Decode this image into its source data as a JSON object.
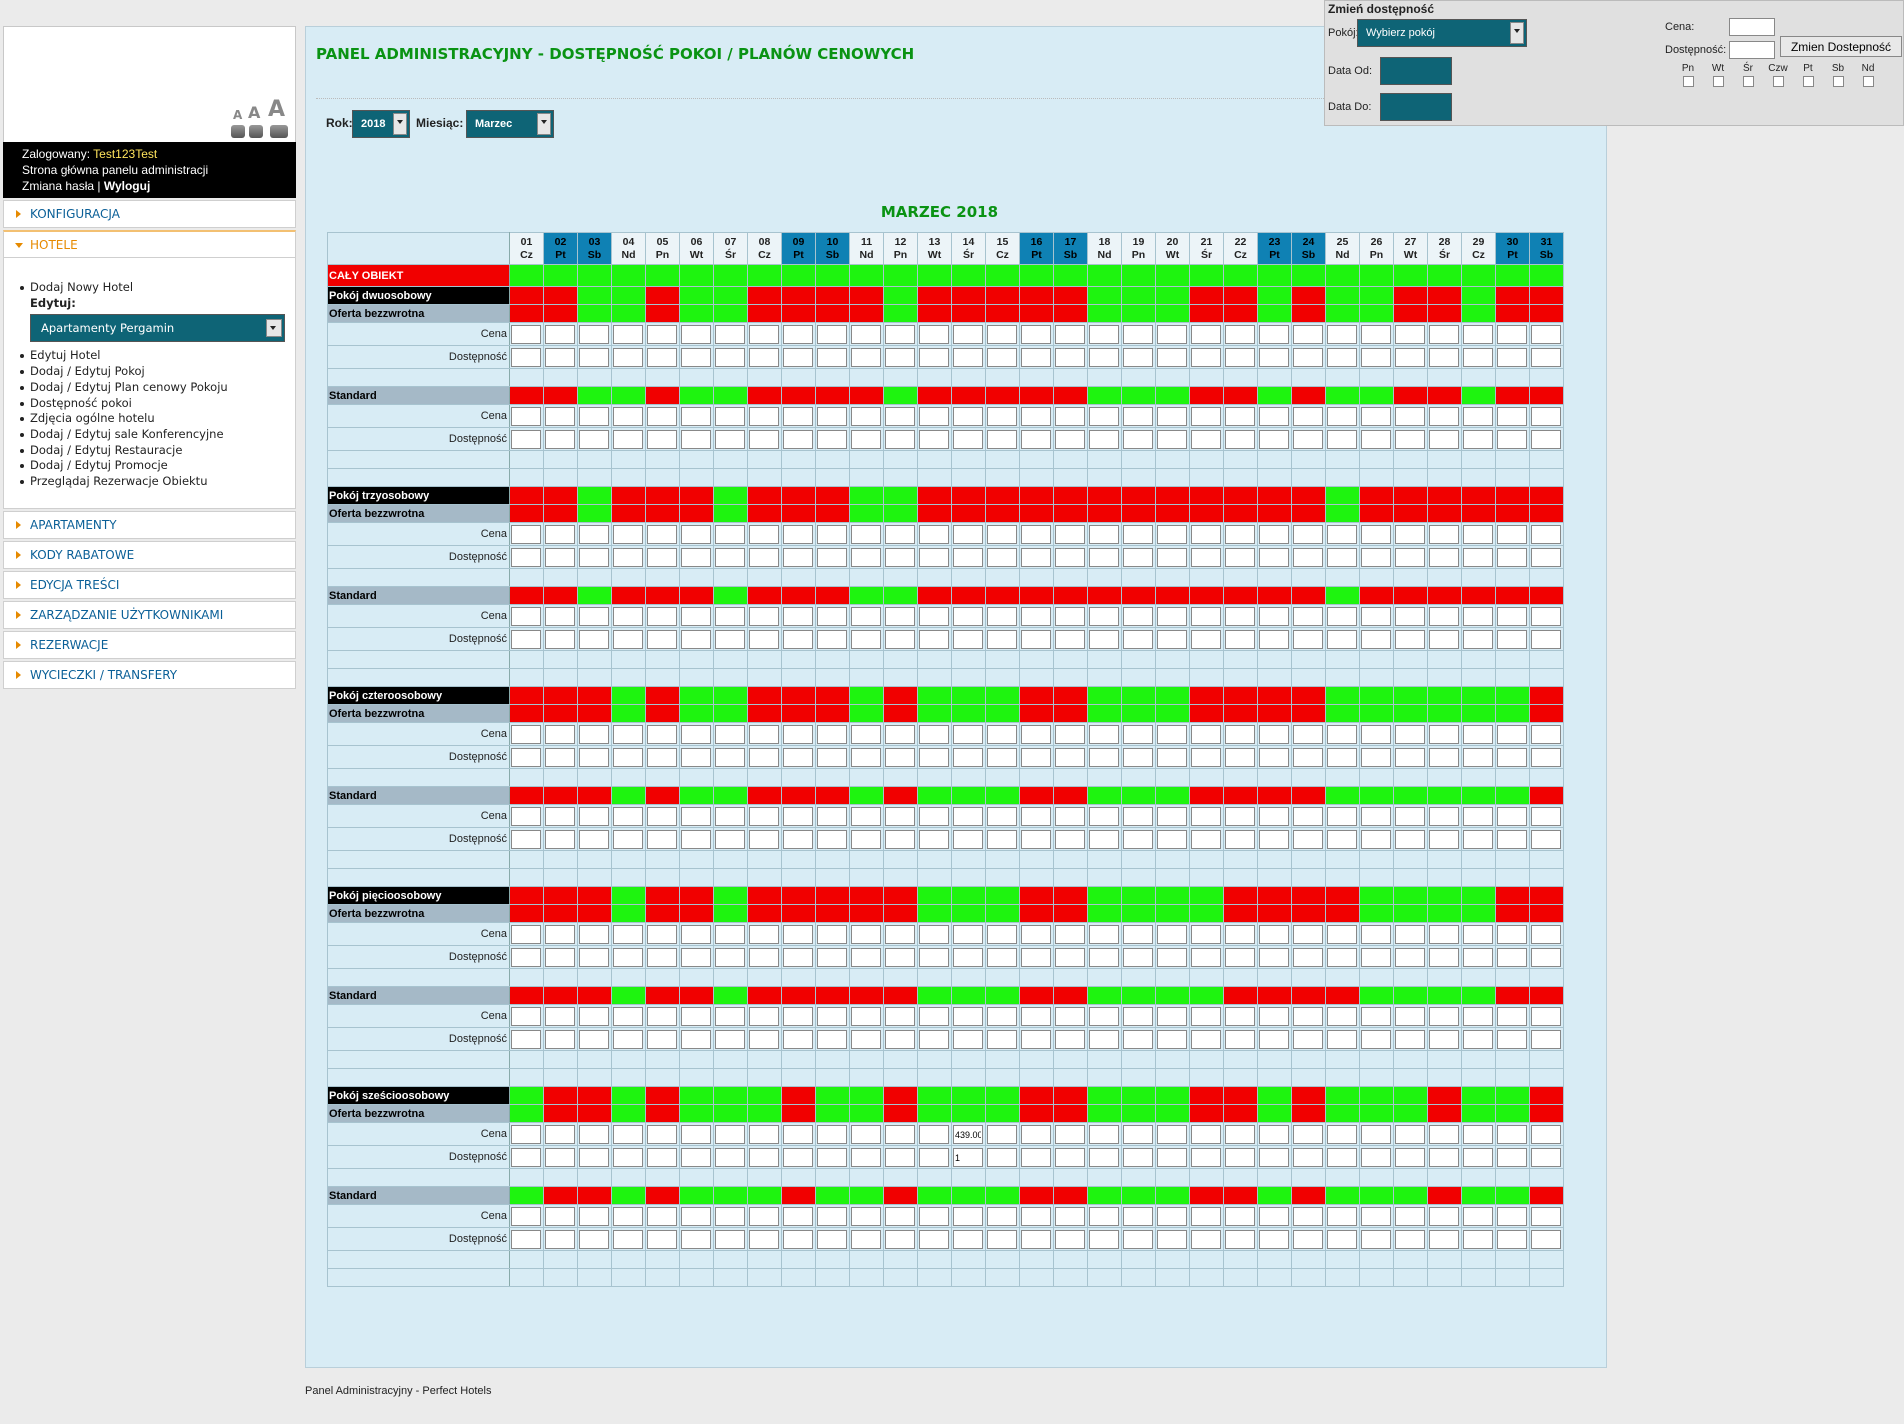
{
  "sidebar": {
    "font_letters": [
      "A",
      "A",
      "A"
    ],
    "login_label": "Zalogowany:",
    "login_user": "Test123Test",
    "home_link": "Strona główna panelu administracji",
    "change_password": "Zmiana hasła",
    "separator": "|",
    "logout": "Wyloguj",
    "menu_top": "KONFIGURACJA",
    "menu_open": "HOTELE",
    "submenu_first": "Dodaj Nowy Hotel",
    "edit_label": "Edytuj:",
    "hotel_select": "Apartamenty Pergamin",
    "submenu_items": [
      "Edytuj Hotel",
      "Dodaj / Edytuj Pokoj",
      "Dodaj / Edytuj Plan cenowy Pokoju",
      "Dostępność pokoi",
      "Zdjęcia ogólne hotelu",
      "Dodaj / Edytuj sale Konferencyjne",
      "Dodaj / Edytuj Restauracje",
      "Dodaj / Edytuj Promocje",
      "Przeglądaj Rezerwacje Obiektu"
    ],
    "menu_bottom": [
      "APARTAMENTY",
      "KODY RABATOWE",
      "EDYCJA TREŚCI",
      "ZARZĄDZANIE UŻYTKOWNIKAMI",
      "REZERWACJE",
      "WYCIECZKI / TRANSFERY"
    ]
  },
  "main": {
    "title": "PANEL ADMINISTRACYJNY - DOSTĘPNOŚĆ POKOI / PLANÓW CENOWYCH",
    "year_label": "Rok:",
    "year_value": "2018",
    "month_label": "Miesiąc:",
    "month_value": "Marzec",
    "month_title": "MARZEC 2018",
    "whole_object": "CAŁY OBIEKT",
    "price_label": "Cena",
    "avail_label": "Dostępność"
  },
  "calendar": {
    "days": [
      "01",
      "02",
      "03",
      "04",
      "05",
      "06",
      "07",
      "08",
      "09",
      "10",
      "11",
      "12",
      "13",
      "14",
      "15",
      "16",
      "17",
      "18",
      "19",
      "20",
      "21",
      "22",
      "23",
      "24",
      "25",
      "26",
      "27",
      "28",
      "29",
      "30",
      "31"
    ],
    "weekdays": [
      "Cz",
      "Pt",
      "Sb",
      "Nd",
      "Pn",
      "Wt",
      "Śr",
      "Cz",
      "Pt",
      "Sb",
      "Nd",
      "Pn",
      "Wt",
      "Śr",
      "Cz",
      "Pt",
      "Sb",
      "Nd",
      "Pn",
      "Wt",
      "Śr",
      "Cz",
      "Pt",
      "Sb",
      "Nd",
      "Pn",
      "Wt",
      "Śr",
      "Cz",
      "Pt",
      "Sb"
    ],
    "highlighted_days": [
      2,
      3,
      9,
      10,
      16,
      17,
      23,
      24,
      30,
      31
    ],
    "rooms": [
      {
        "name": "Pokój dwuosobowy",
        "plans": [
          {
            "name": "Oferta bezzwrotna",
            "status": "RRGGRGGRRRRGRRRRRGGGRRGRGGRRGRR"
          },
          {
            "name": "Standard",
            "status": "RRGGRGGRRRRGRRRRRGGGRRGRGGRRGRR"
          }
        ]
      },
      {
        "name": "Pokój trzyosobowy",
        "plans": [
          {
            "name": "Oferta bezzwrotna",
            "status": "RRGRRRGRRRGGRRRRRRRRRRRRGRRRRRR"
          },
          {
            "name": "Standard",
            "status": "RRGRRRGRRRGGRRRRRRRRRRRRGRRRRRR"
          }
        ]
      },
      {
        "name": "Pokój czteroosobowy",
        "plans": [
          {
            "name": "Oferta bezzwrotna",
            "status": "RRRGRGGRRRGRGGGRRGGGRRRRGGGGGGRR"
          },
          {
            "name": "Standard",
            "status": "RRRGRGGRRRGRGGGRRGGGRRRRGGGGGGRR"
          }
        ]
      },
      {
        "name": "Pokój pięcioosobowy",
        "plans": [
          {
            "name": "Oferta bezzwrotna",
            "status": "RRRGRRGRRRRRGGGRRGGGGRRRRGGGGRR"
          },
          {
            "name": "Standard",
            "status": "RRRGRRGRRRRRGGGRRGGGGRRRRGGGGRR"
          }
        ]
      },
      {
        "name": "Pokój sześcioosobowy",
        "plans": [
          {
            "name": "Oferta bezzwrotna",
            "status": "GRRGRGGGRGGRGGGRRGGGRRGRGGGRGGR",
            "price_values": {
              "13": "439.00"
            },
            "avail_values": {
              "13": "1"
            }
          },
          {
            "name": "Standard",
            "status": "GRRGRGGGRGGRGGGRRGGGRRGRGGGRGGR"
          }
        ]
      }
    ]
  },
  "avail_panel": {
    "title": "Zmień dostępność",
    "room_label": "Pokój:",
    "room_select": "Wybierz pokój",
    "date_from": "Data Od:",
    "date_to": "Data Do:",
    "price_label": "Cena:",
    "avail_label": "Dostępność:",
    "button": "Zmien Dostepność",
    "weekdays": [
      "Pn",
      "Wt",
      "Śr",
      "Czw",
      "Pt",
      "Sb",
      "Nd"
    ]
  },
  "footer": "Panel Administracyjny - Perfect Hotels",
  "colors": {
    "available": "#1ef40f",
    "unavailable": "#f10000",
    "highlight_day": "#0f81b4",
    "title_green": "#0a9313",
    "teal": "#0e6476"
  }
}
